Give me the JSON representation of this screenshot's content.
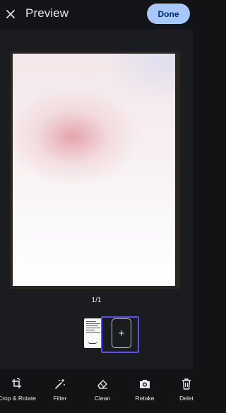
{
  "header": {
    "title": "Preview",
    "done_label": "Done",
    "close_icon": "close-icon"
  },
  "preview": {
    "page_counter": "1/1"
  },
  "thumbnails": {
    "add_icon": "plus-icon",
    "add_label": "+"
  },
  "toolbar": {
    "items": [
      {
        "label": "Crop & Rotate",
        "icon": "crop-rotate-icon"
      },
      {
        "label": "Filter",
        "icon": "magic-wand-icon"
      },
      {
        "label": "Clean",
        "icon": "eraser-icon"
      },
      {
        "label": "Retake",
        "icon": "camera-icon"
      },
      {
        "label": "Delet",
        "icon": "trash-icon"
      }
    ]
  },
  "colors": {
    "background": "#121314",
    "stage": "#1b1c1f",
    "done_button": "#a8c7fa",
    "highlight": "#5b4df0"
  }
}
